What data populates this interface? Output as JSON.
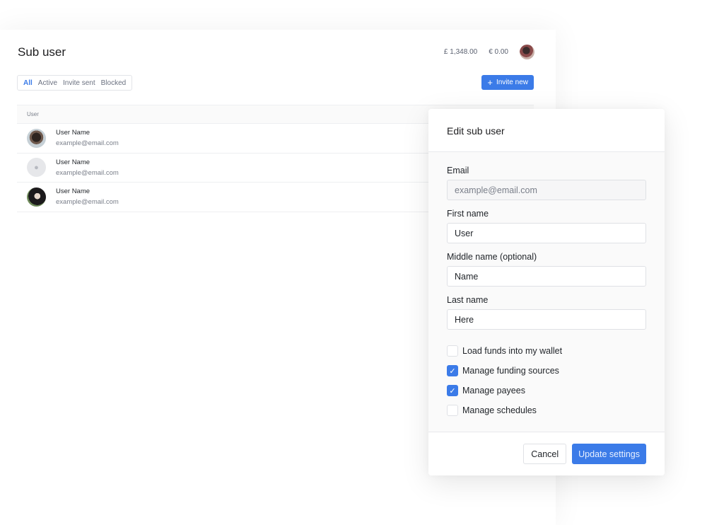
{
  "page": {
    "title": "Sub user",
    "balances": [
      "£ 1,348.00",
      "€ 0.00"
    ],
    "invite_label": "Invite new",
    "invite_icon": "plus-icon"
  },
  "filters": [
    {
      "label": "All",
      "active": true
    },
    {
      "label": "Active",
      "active": false
    },
    {
      "label": "Invite sent",
      "active": false
    },
    {
      "label": "Blocked",
      "active": false
    }
  ],
  "table": {
    "header": "User",
    "rows": [
      {
        "name": "User Name",
        "email": "example@email.com",
        "avatar": "photo"
      },
      {
        "name": "User Name",
        "email": "example@email.com",
        "avatar": "placeholder-user-icon"
      },
      {
        "name": "User Name",
        "email": "example@email.com",
        "avatar": "photo"
      }
    ]
  },
  "modal": {
    "title": "Edit sub user",
    "fields": {
      "email": {
        "label": "Email",
        "value": "",
        "placeholder": "example@email.com"
      },
      "first": {
        "label": "First name",
        "value": "User"
      },
      "middle": {
        "label": "Middle name (optional)",
        "value": "Name"
      },
      "last": {
        "label": "Last name",
        "value": "Here"
      }
    },
    "permissions": [
      {
        "label": "Load funds into my wallet",
        "checked": false
      },
      {
        "label": "Manage funding sources",
        "checked": true
      },
      {
        "label": "Manage payees",
        "checked": true
      },
      {
        "label": "Manage schedules",
        "checked": false
      }
    ],
    "cancel_label": "Cancel",
    "submit_label": "Update settings"
  },
  "colors": {
    "accent": "#3b7be8"
  }
}
